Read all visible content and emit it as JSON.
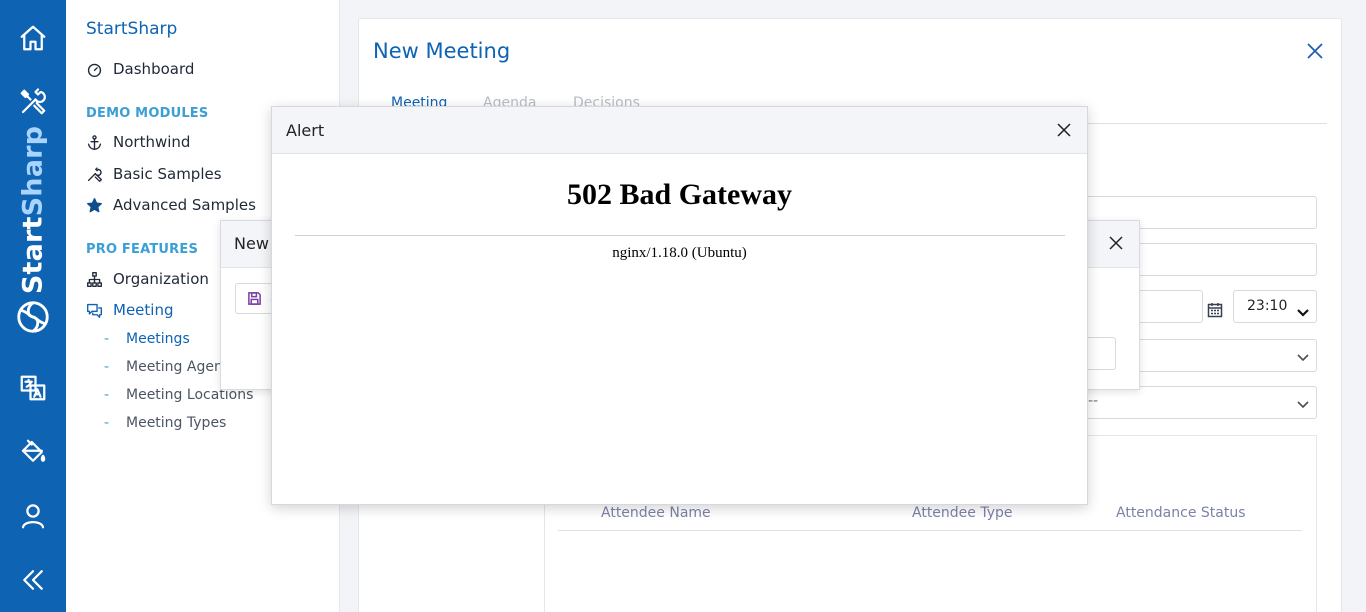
{
  "rail": {
    "brand_part1": "Start",
    "brand_part2": "Sharp",
    "icons": [
      "home-icon",
      "tools-icon",
      "translate-icon",
      "paint-bucket-icon",
      "user-icon",
      "collapse-icon"
    ]
  },
  "sidebar": {
    "title": "StartSharp",
    "dashboard": "Dashboard",
    "section_demo": "DEMO MODULES",
    "northwind": "Northwind",
    "basic_samples": "Basic Samples",
    "advanced_samples": "Advanced Samples",
    "section_pro": "PRO FEATURES",
    "organization": "Organization",
    "meeting": "Meeting",
    "sub_items": [
      "Meetings",
      "Meeting Agenda Types",
      "Meeting Locations",
      "Meeting Types"
    ],
    "sub_dash": "-"
  },
  "panel": {
    "title": "New Meeting",
    "tabs": [
      "Meeting",
      "Agenda",
      "Decisions"
    ],
    "time_value": "23:10",
    "placeholder_dashes": "--",
    "grid_columns": [
      "Attendee Name",
      "Attendee Type",
      "Attendance Status"
    ]
  },
  "dialog2": {
    "title": "New",
    "save_label": "S"
  },
  "alert": {
    "title": "Alert",
    "heading": "502 Bad Gateway",
    "footer": "nginx/1.18.0 (Ubuntu)"
  },
  "colors": {
    "brand_blue": "#0e63b3",
    "section_blue": "#3a9fd6",
    "grid_header": "#7d82a6"
  }
}
